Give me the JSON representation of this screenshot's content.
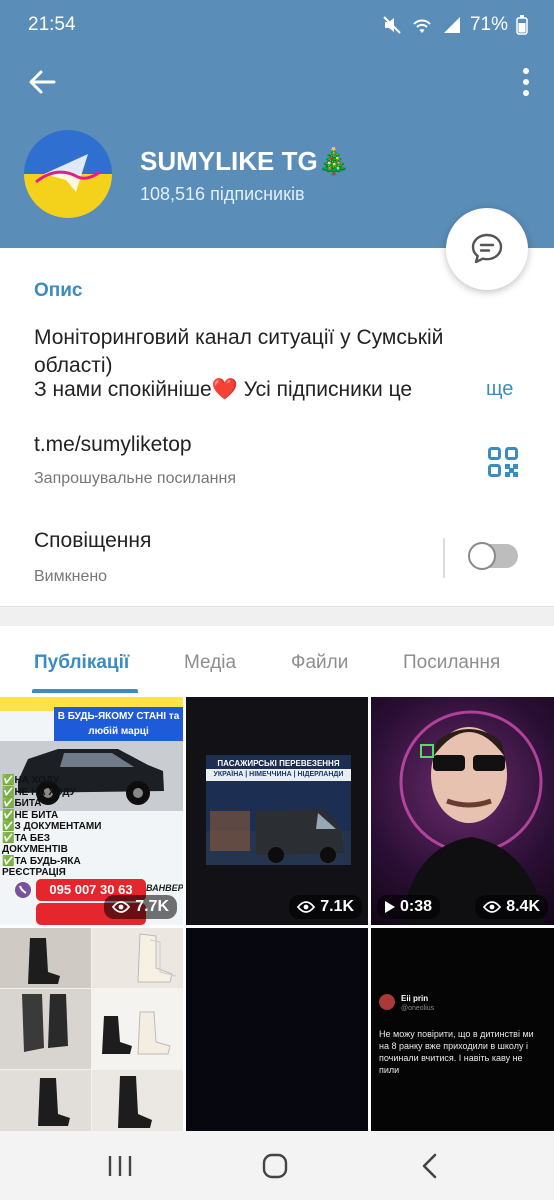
{
  "status": {
    "time": "21:54",
    "battery": "71%"
  },
  "header": {
    "title": "SUMYLIKE TG🎄",
    "subscribers": "108,516 підписників"
  },
  "info": {
    "description_label": "Опис",
    "description_line1": "Моніторинговий канал ситуації у Сумській області)",
    "description_line2": " З нами спокійніше❤️  Усі підписники це",
    "more": "ще",
    "link": "t.me/sumyliketop",
    "link_caption": "Запрошувальне посилання",
    "notifications_label": "Сповіщення",
    "notifications_state": "Вимкнено"
  },
  "tabs": [
    "Публікації",
    "Медіа",
    "Файли",
    "Посилання"
  ],
  "media": [
    {
      "views": "7.7K",
      "text_top": "В БУДЬ-ЯКОМУ СТАНІ та любій марці",
      "list": [
        "✅НА ХОДУ",
        "✅НЕ НА ХОДУ",
        "✅БИТА",
        "✅НЕ БИТА",
        "✅З ДОКУМЕНТАМИ",
        "✅ТА БЕЗ ДОКУМЕНТІВ",
        "✅ТА БУДЬ-ЯКА",
        "РЕЄСТРАЦІЯ"
      ],
      "phone": "095 007 30 63",
      "watermark": "ВАНВЕР"
    },
    {
      "views": "7.1K",
      "banner": "ПАСАЖИРСЬКІ ПЕРЕВЕЗЕННЯ",
      "route": "УКРАЇНА | НІМЕЧЧИНА | НІДЕРЛАНДИ"
    },
    {
      "views": "8.4K",
      "duration": "0:38"
    },
    {},
    {},
    {
      "author": "Eii prin",
      "handle": "@oneolius",
      "tweet": "Не можу повірити, що в дитинстві ми на 8 ранку вже приходили в школу і починали вчитися. І навіть каву не пили"
    }
  ],
  "colors": {
    "header": "#5a8db8",
    "accent": "#3a8cc4"
  }
}
